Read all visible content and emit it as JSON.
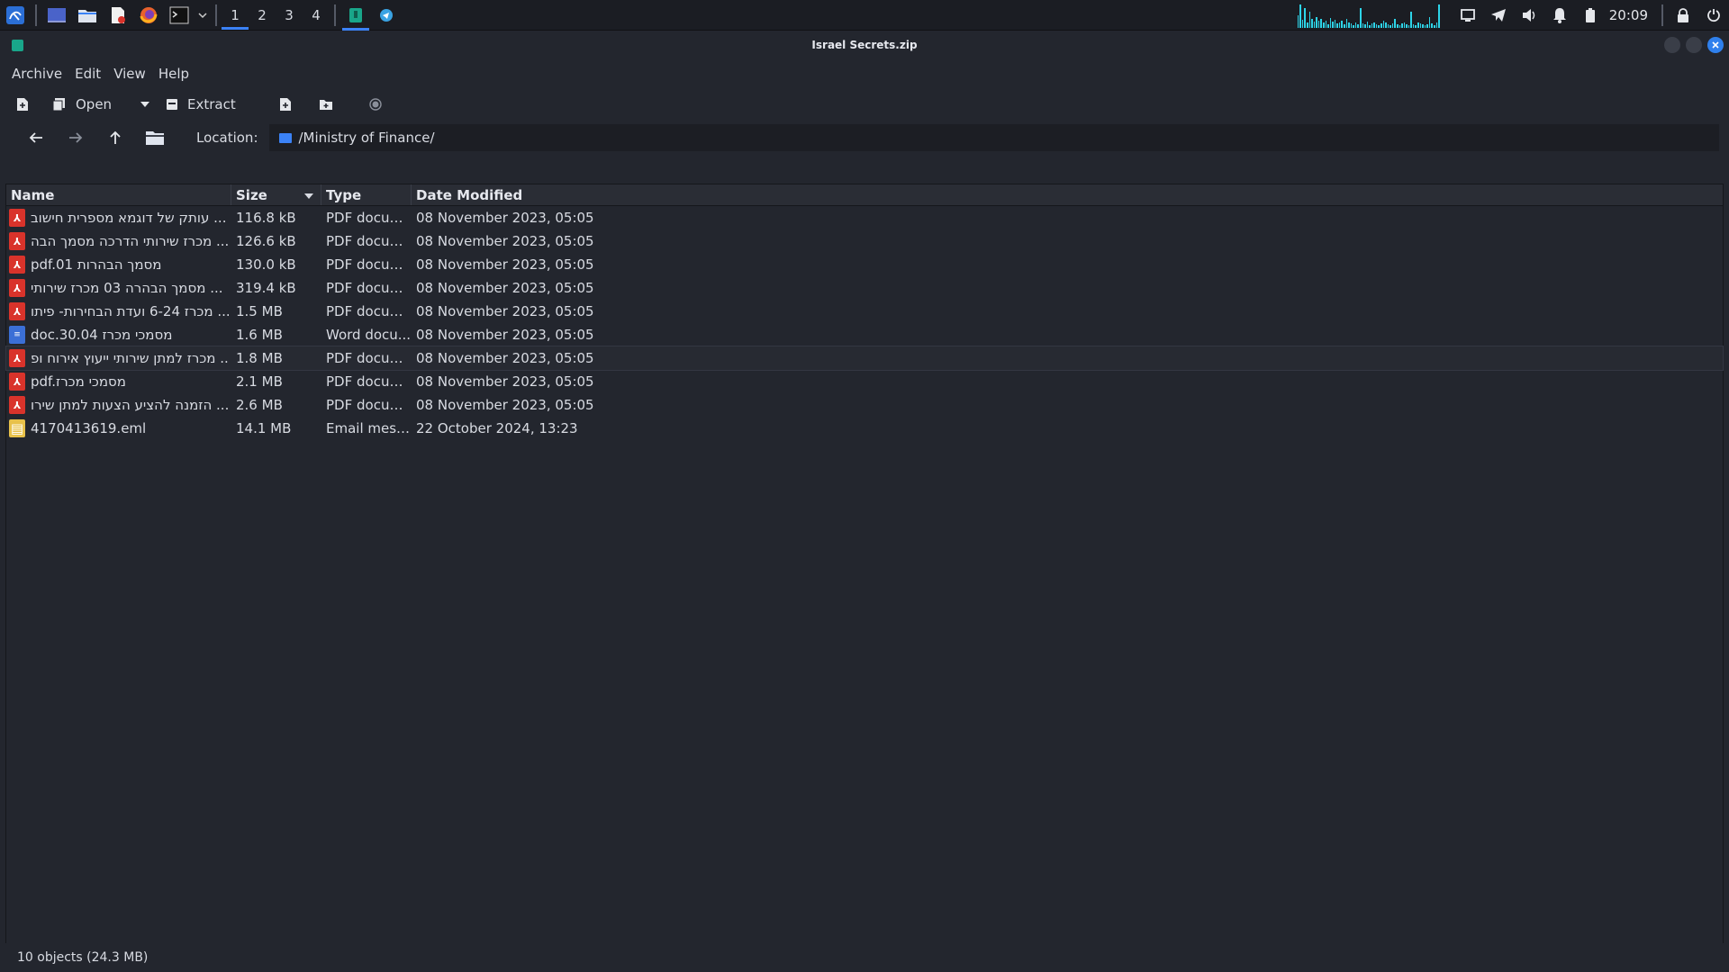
{
  "taskbar": {
    "workspaces": [
      "1",
      "2",
      "3",
      "4"
    ],
    "active_workspace": "1",
    "clock": "20:09",
    "graph_bars": [
      14,
      26,
      9,
      22,
      6,
      18,
      10,
      7,
      12,
      8,
      10,
      6,
      8,
      4,
      11,
      7,
      9,
      5,
      6,
      8,
      4,
      10,
      6,
      5,
      3,
      6,
      4,
      22,
      5,
      4,
      7,
      3,
      5,
      6,
      4,
      3,
      5,
      8,
      6,
      4,
      3,
      5,
      10,
      4,
      3,
      5,
      6,
      4,
      3,
      18,
      4,
      3,
      6,
      5,
      4,
      3,
      4,
      12,
      5,
      3,
      6,
      26
    ],
    "accent": "#3b82f6",
    "graph_color": "#2dd4e8"
  },
  "window": {
    "title": "Israel Secrets.zip"
  },
  "menu": [
    "Archive",
    "Edit",
    "View",
    "Help"
  ],
  "toolbar": {
    "open_label": "Open",
    "extract_label": "Extract"
  },
  "location": {
    "label": "Location:",
    "path": "/Ministry of Finance/"
  },
  "columns": {
    "name": "Name",
    "size": "Size",
    "type": "Type",
    "date": "Date Modified"
  },
  "files": [
    {
      "name": "עותק של דוגמא מספרית חישוב ...",
      "size": "116.8 kB",
      "type": "PDF docum...",
      "date": "08 November 2023, 05:05",
      "kind": "pdf"
    },
    {
      "name": "מכרז שירותי הדרכה מסמך הבה ...",
      "size": "126.6 kB",
      "type": "PDF docum...",
      "date": "08 November 2023, 05:05",
      "kind": "pdf"
    },
    {
      "name": "pdf.01 מסמך הבהרות",
      "size": "130.0 kB",
      "type": "PDF docum...",
      "date": "08 November 2023, 05:05",
      "kind": "pdf"
    },
    {
      "name": "מסמך הבהרה 03 מכרז שירותי   ...",
      "size": "319.4 kB",
      "type": "PDF docum...",
      "date": "08 November 2023, 05:05",
      "kind": "pdf"
    },
    {
      "name": "מכרז 6-24 ועדת הבחירות- פיתו ...",
      "size": "1.5 MB",
      "type": "PDF docum...",
      "date": "08 November 2023, 05:05",
      "kind": "pdf"
    },
    {
      "name": "doc.30.04 מסמכי מכרז",
      "size": "1.6 MB",
      "type": "Word docu...",
      "date": "08 November 2023, 05:05",
      "kind": "word"
    },
    {
      "name": "מכרז למתן שירותי ייעוץ אירוח ופ ...",
      "size": "1.8 MB",
      "type": "PDF docum...",
      "date": "08 November 2023, 05:05",
      "kind": "pdf"
    },
    {
      "name": "pdf.מסמכי מכרז",
      "size": "2.1 MB",
      "type": "PDF docum...",
      "date": "08 November 2023, 05:05",
      "kind": "pdf"
    },
    {
      "name": "הזמנה להציע הצעות למתן שירו ...",
      "size": "2.6 MB",
      "type": "PDF docum...",
      "date": "08 November 2023, 05:05",
      "kind": "pdf"
    },
    {
      "name": "4170413619.eml",
      "size": "14.1 MB",
      "type": "Email mess...",
      "date": "22 October 2024, 13:23",
      "kind": "eml"
    }
  ],
  "highlighted_row": 6,
  "status": "10 objects (24.3 MB)"
}
